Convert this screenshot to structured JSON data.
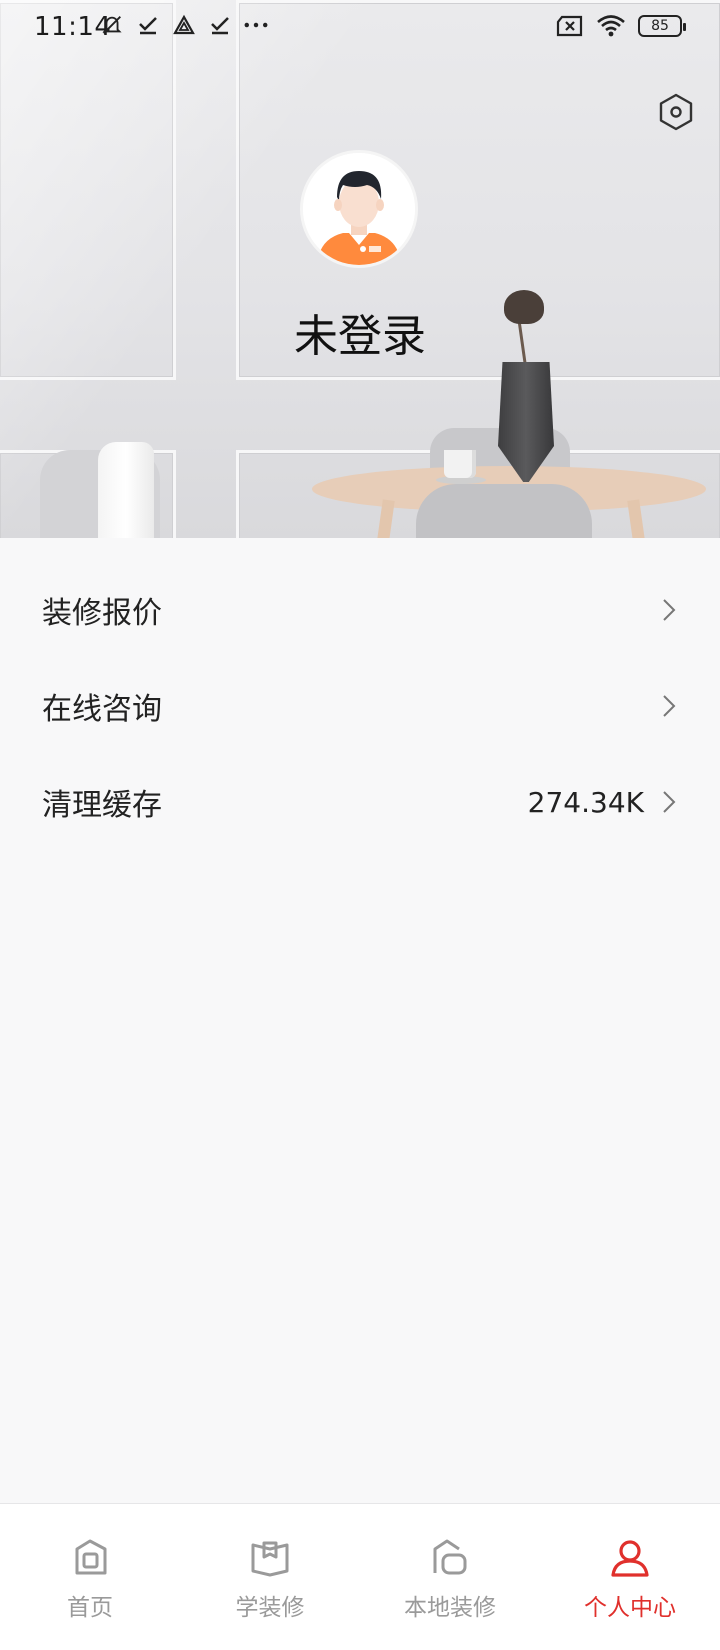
{
  "status_bar": {
    "time": "11:14",
    "battery": "85",
    "icons_left": [
      "muted-icon",
      "check-icon",
      "triangle-app-icon",
      "check-icon",
      "more-dots-icon"
    ],
    "icons_right": [
      "sim-x-icon",
      "wifi-icon",
      "battery-icon"
    ]
  },
  "profile": {
    "username": "未登录",
    "settings_icon": "settings-hexagon-icon"
  },
  "menu": {
    "items": [
      {
        "label": "装修报价",
        "value": ""
      },
      {
        "label": "在线咨询",
        "value": ""
      },
      {
        "label": "清理缓存",
        "value": "274.34K"
      }
    ]
  },
  "bottom_nav": {
    "items": [
      {
        "label": "首页",
        "icon": "home-icon",
        "active": false
      },
      {
        "label": "学装修",
        "icon": "book-icon",
        "active": false
      },
      {
        "label": "本地装修",
        "icon": "local-house-icon",
        "active": false
      },
      {
        "label": "个人中心",
        "icon": "person-icon",
        "active": true
      }
    ]
  },
  "colors": {
    "accent": "#e0302c",
    "inactive": "#9a9a9a",
    "background": "#f8f8f9",
    "avatar_shirt": "#ff8a3d"
  }
}
